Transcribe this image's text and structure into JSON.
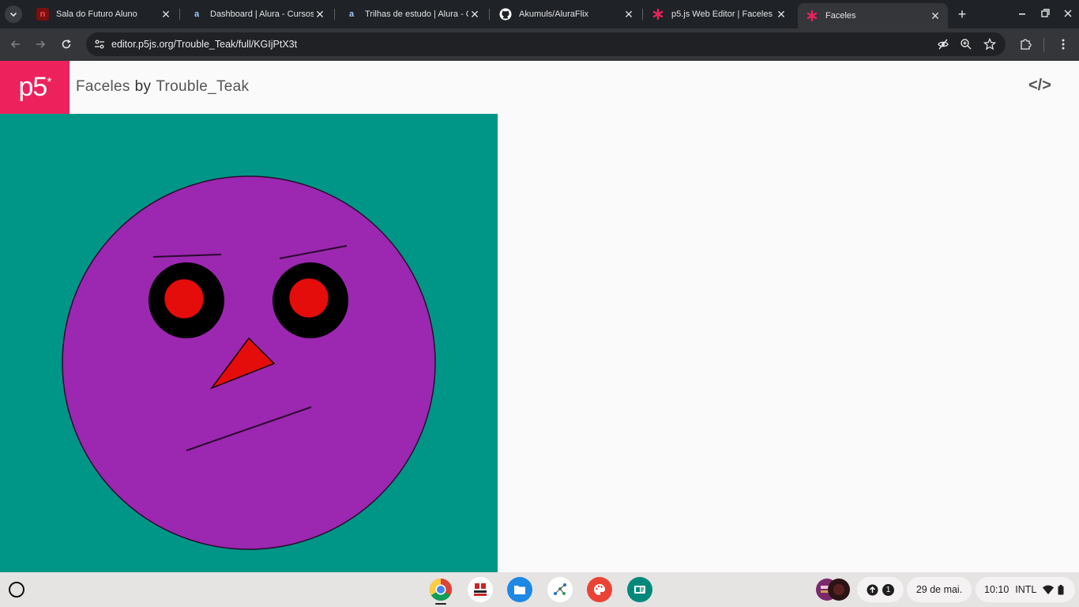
{
  "browser": {
    "tabs": [
      {
        "title": "Sala do Futuro Aluno",
        "icon": "sala-futuro-icon",
        "active": false
      },
      {
        "title": "Dashboard | Alura - Cursos",
        "icon": "alura-icon",
        "active": false
      },
      {
        "title": "Trilhas de estudo | Alura - C",
        "icon": "alura-icon",
        "active": false
      },
      {
        "title": "Akumuls/AluraFlix",
        "icon": "github-icon",
        "active": false
      },
      {
        "title": "p5.js Web Editor | Faceles",
        "icon": "p5-asterisk-icon",
        "active": false
      },
      {
        "title": "Faceles",
        "icon": "p5-asterisk-icon",
        "active": true
      }
    ],
    "address": {
      "url": "editor.p5js.org/Trouble_Teak/full/KGIjPtX3t"
    }
  },
  "p5": {
    "logo": "p5",
    "logo_mark": "*",
    "sketch_name": "Faceles",
    "by": "by",
    "author": "Trouble_Teak",
    "code_link": "</>"
  },
  "sketch": {
    "background_color": "#009687",
    "face_color": "#9c27b0",
    "eye_outer_color": "#000000",
    "eye_inner_color": "#e50c0c",
    "nose_color": "#e50c0c"
  },
  "shelf": {
    "apps": [
      {
        "name": "chrome-app"
      },
      {
        "name": "sala-futuro-app"
      },
      {
        "name": "files-app"
      },
      {
        "name": "canvas-app"
      },
      {
        "name": "paint-app"
      },
      {
        "name": "classroom-app"
      }
    ],
    "notification_count": "1",
    "date": "29 de mai.",
    "time": "10:10",
    "input_method": "INTL"
  }
}
